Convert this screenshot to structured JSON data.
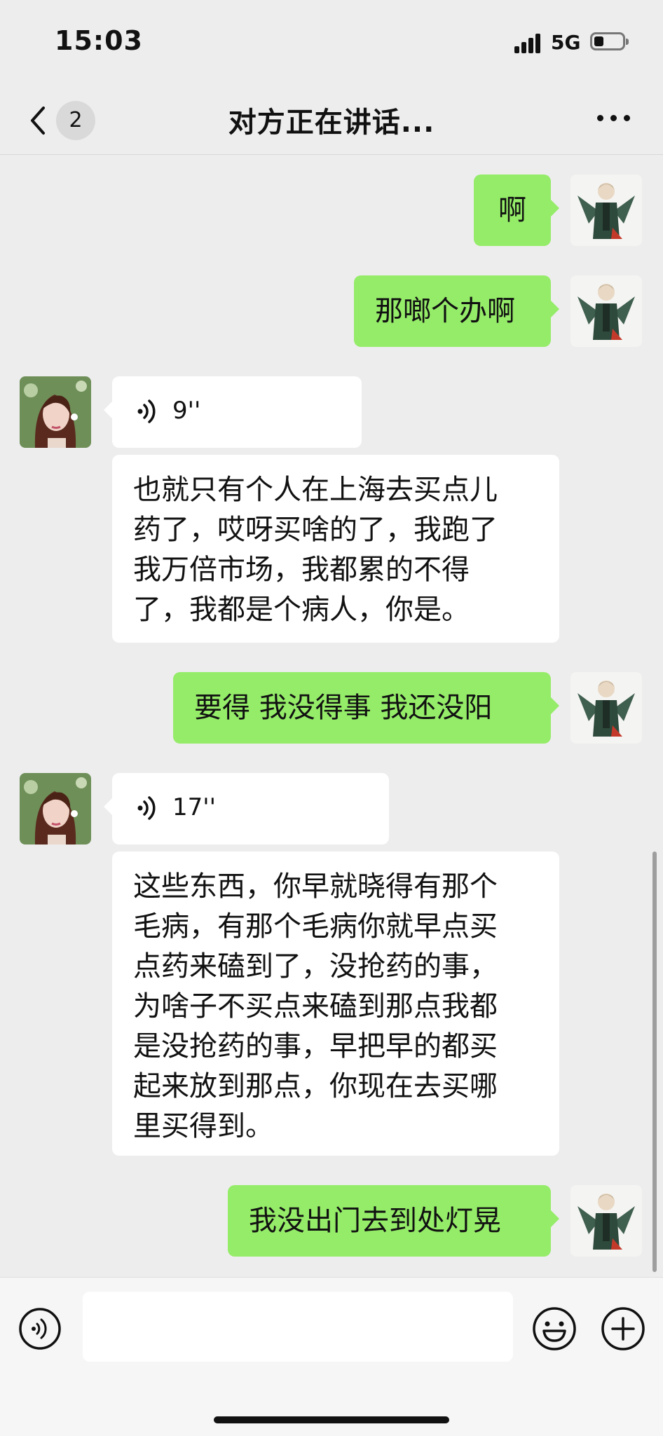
{
  "status": {
    "time": "15:03",
    "network": "5G",
    "battery_level": 0.35
  },
  "nav": {
    "back_icon": "chevron-left-icon",
    "unread_count": "2",
    "title": "对方正在讲话...",
    "more_icon": "more-dots-icon"
  },
  "messages": [
    {
      "side": "me",
      "type": "text",
      "text": "啊"
    },
    {
      "side": "me",
      "type": "text",
      "text": "那啷个办啊"
    },
    {
      "side": "her",
      "type": "voice",
      "duration": "9''",
      "transcript": [
        "也就只有个人在上海去买点儿",
        "药了，哎呀买啥的了，我跑了",
        "我万倍市场，我都累的不得",
        "了，我都是个病人，你是。"
      ]
    },
    {
      "side": "me",
      "type": "text",
      "text": "要得 我没得事 我还没阳"
    },
    {
      "side": "her",
      "type": "voice",
      "duration": "17''",
      "transcript": [
        "这些东西，你早就晓得有那个",
        "毛病，有那个毛病你就早点买",
        "点药来磕到了，没抢药的事，",
        "为啥子不买点来磕到那点我都",
        "是没抢药的事，早把早的都买",
        "起来放到那点，你现在去买哪",
        "里买得到。"
      ]
    },
    {
      "side": "me",
      "type": "text",
      "text": "我没出门去到处灯晃"
    }
  ],
  "input_bar": {
    "voice_icon": "voice-input-icon",
    "text_value": "",
    "emoji_icon": "emoji-icon",
    "plus_icon": "plus-icon"
  },
  "colors": {
    "background": "#ededed",
    "my_bubble": "#95ec69",
    "their_bubble": "#ffffff"
  }
}
